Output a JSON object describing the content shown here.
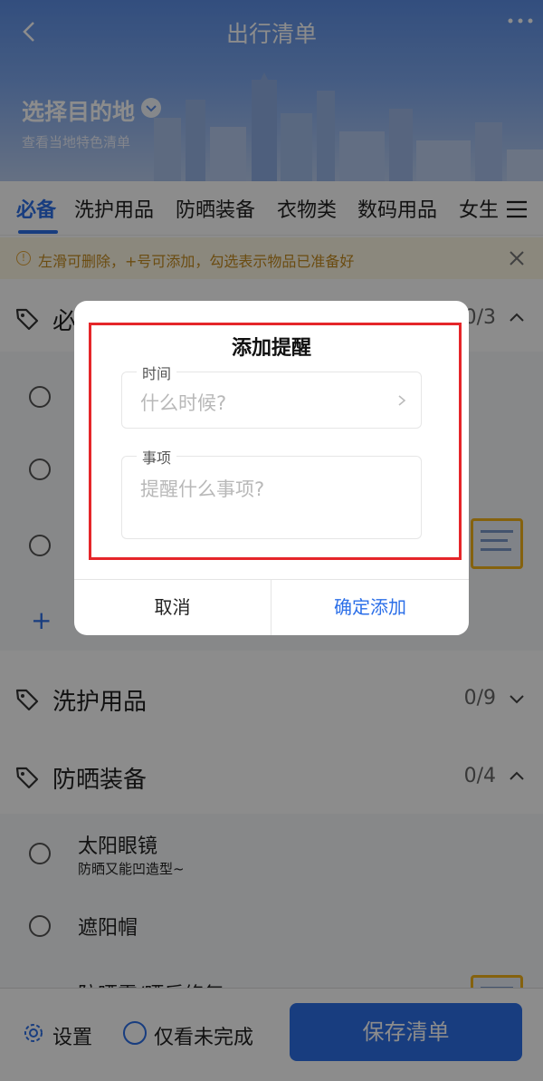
{
  "header": {
    "title": "出行清单",
    "destination_title": "选择目的地",
    "destination_subtitle": "查看当地特色清单"
  },
  "tabs": [
    "必备",
    "洗护用品",
    "防晒装备",
    "衣物类",
    "数码用品",
    "女生"
  ],
  "tip": {
    "text": "左滑可删除，+号可添加，勾选表示物品已准备好"
  },
  "sections": [
    {
      "title": "必",
      "count": "0/3",
      "expanded": true
    },
    {
      "title": "洗护用品",
      "count": "0/9",
      "expanded": false
    },
    {
      "title": "防晒装备",
      "count": "0/4",
      "expanded": true
    }
  ],
  "sunscreen_items": [
    {
      "name": "太阳眼镜",
      "desc": "防晒又能凹造型~"
    },
    {
      "name": "遮阳帽",
      "desc": ""
    },
    {
      "name": "防晒霜/晒后修复",
      "desc": ""
    }
  ],
  "add_symbol": "+",
  "bottom": {
    "settings_label": "设置",
    "only_incomplete_label": "仅看未完成",
    "save_label": "保存清单"
  },
  "dialog": {
    "title": "添加提醒",
    "time_label": "时间",
    "time_placeholder": "什么时候?",
    "matter_label": "事项",
    "matter_placeholder": "提醒什么事项?",
    "cancel_label": "取消",
    "confirm_label": "确定添加"
  },
  "colors": {
    "accent": "#2c6fe8",
    "highlight": "#e5262a",
    "tip_text": "#c48a1f"
  }
}
